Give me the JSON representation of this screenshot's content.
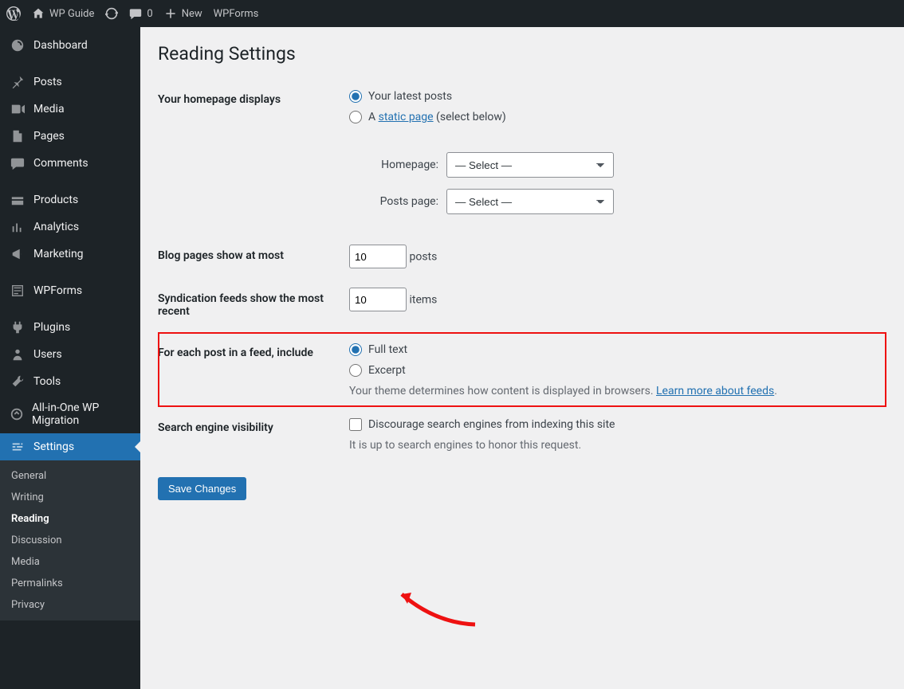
{
  "topbar": {
    "site_name": "WP Guide",
    "comments_count": "0",
    "new_label": "New",
    "wpforms_label": "WPForms"
  },
  "sidebar": {
    "items": [
      {
        "label": "Dashboard"
      },
      {
        "label": "Posts"
      },
      {
        "label": "Media"
      },
      {
        "label": "Pages"
      },
      {
        "label": "Comments"
      },
      {
        "label": "Products"
      },
      {
        "label": "Analytics"
      },
      {
        "label": "Marketing"
      },
      {
        "label": "WPForms"
      },
      {
        "label": "Plugins"
      },
      {
        "label": "Users"
      },
      {
        "label": "Tools"
      },
      {
        "label": "All-in-One WP Migration"
      },
      {
        "label": "Settings"
      }
    ],
    "submenu": [
      {
        "label": "General"
      },
      {
        "label": "Writing"
      },
      {
        "label": "Reading"
      },
      {
        "label": "Discussion"
      },
      {
        "label": "Media"
      },
      {
        "label": "Permalinks"
      },
      {
        "label": "Privacy"
      }
    ]
  },
  "page": {
    "title": "Reading Settings",
    "homepage_displays_label": "Your homepage displays",
    "hp_opt_latest": "Your latest posts",
    "hp_opt_static_a": "A ",
    "hp_opt_static_link": "static page",
    "hp_opt_static_tail": " (select below)",
    "homepage_sel_label": "Homepage:",
    "postspage_sel_label": "Posts page:",
    "select_placeholder": "— Select —",
    "blog_pages_label": "Blog pages show at most",
    "blog_pages_value": "10",
    "blog_pages_unit": "posts",
    "syndication_label": "Syndication feeds show the most recent",
    "syndication_value": "10",
    "syndication_unit": "items",
    "feed_include_label": "For each post in a feed, include",
    "feed_opt_full": "Full text",
    "feed_opt_excerpt": "Excerpt",
    "feed_help_pre": "Your theme determines how content is displayed in browsers. ",
    "feed_help_link": "Learn more about feeds",
    "feed_help_post": ".",
    "search_vis_label": "Search engine visibility",
    "search_vis_opt": "Discourage search engines from indexing this site",
    "search_vis_help": "It is up to search engines to honor this request.",
    "save_label": "Save Changes"
  }
}
